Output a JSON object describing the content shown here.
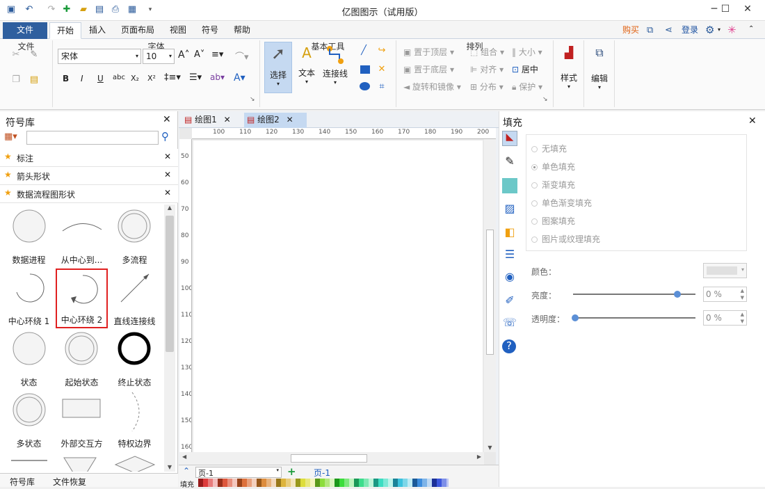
{
  "window": {
    "title": "亿图图示（试用版）",
    "minimize": "─",
    "maximize": "☐",
    "close": "✕"
  },
  "quick_access": [
    "undo",
    "redo",
    "new",
    "open",
    "save",
    "print",
    "export"
  ],
  "menu": {
    "file": "文件",
    "tabs": [
      "开始",
      "插入",
      "页面布局",
      "视图",
      "符号",
      "帮助"
    ],
    "buy": "购买",
    "login": "登录"
  },
  "ribbon": {
    "groups": {
      "file": "文件",
      "font": "字体",
      "basic_tools": "基本工具",
      "arrange": "排列",
      "style": "样式",
      "edit": "编辑"
    },
    "font_name": "宋体",
    "font_size": "10",
    "tools": {
      "select": "选择",
      "text": "文本",
      "connector": "连接线"
    },
    "arrange": {
      "bring_front": "置于顶层",
      "send_back": "置于底层",
      "rotate": "旋转和镜像",
      "group": "组合",
      "align": "对齐",
      "distribute": "分布",
      "size": "大小",
      "center": "居中",
      "protect": "保护"
    },
    "style_label": "样式",
    "edit_label": "编辑"
  },
  "library": {
    "title": "符号库",
    "search_placeholder": "",
    "sections": [
      "标注",
      "箭头形状",
      "数据流程图形状"
    ],
    "shapes": [
      {
        "label": "数据进程",
        "icon": "circle-icon"
      },
      {
        "label": "从中心到...",
        "icon": "arc-icon"
      },
      {
        "label": "多流程",
        "icon": "double-circle-icon"
      },
      {
        "label": "中心环绕 1",
        "icon": "loop-icon"
      },
      {
        "label": "中心环绕 2",
        "icon": "loop-arrow-icon",
        "selected": true
      },
      {
        "label": "直线连接线",
        "icon": "line-icon"
      },
      {
        "label": "状态",
        "icon": "circle-icon"
      },
      {
        "label": "起始状态",
        "icon": "double-circle-icon"
      },
      {
        "label": "终止状态",
        "icon": "thick-circle-icon"
      },
      {
        "label": "多状态",
        "icon": "double-circle-icon"
      },
      {
        "label": "外部交互方",
        "icon": "rect-icon"
      },
      {
        "label": "特权边界",
        "icon": "dashed-arc-icon"
      }
    ],
    "bottom_tabs": [
      "符号库",
      "文件恢复"
    ]
  },
  "documents": {
    "tabs": [
      "绘图1",
      "绘图2"
    ],
    "active": 1
  },
  "ruler": {
    "h": [
      "100",
      "110",
      "120",
      "130",
      "140",
      "150",
      "160",
      "170",
      "180",
      "190",
      "200"
    ],
    "v": [
      "50",
      "60",
      "70",
      "80",
      "90",
      "100",
      "110",
      "120",
      "130",
      "140",
      "150",
      "160"
    ]
  },
  "pages": {
    "current": "页-1",
    "tab": "页-1",
    "fill_label": "填充"
  },
  "fill_panel": {
    "title": "填充",
    "options": [
      "无填充",
      "单色填充",
      "渐变填充",
      "单色渐变填充",
      "图案填充",
      "图片或纹理填充"
    ],
    "selected": "单色填充",
    "color_label": "颜色：",
    "brightness_label": "亮度：",
    "brightness_value": "0 %",
    "brightness_pos": 0.85,
    "opacity_label": "透明度：",
    "opacity_value": "0 %",
    "opacity_pos": 0
  },
  "colors": {
    "accent": "#2f5f9f",
    "highlight": "#e02020",
    "selection_bg": "#c5d9f1"
  }
}
